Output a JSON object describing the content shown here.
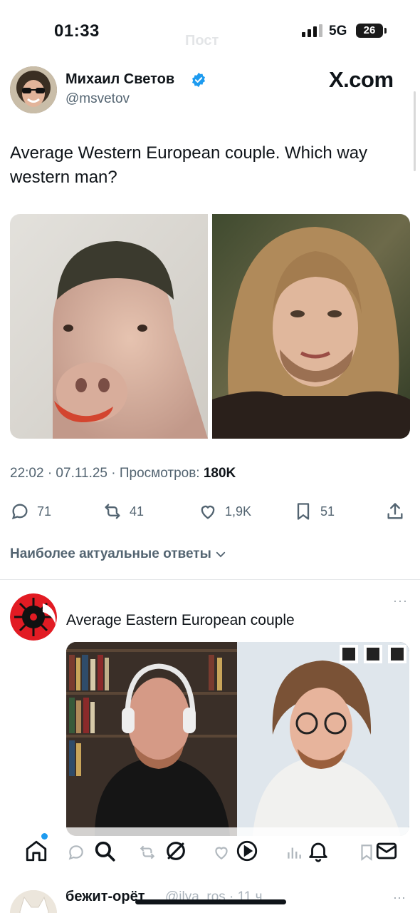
{
  "status_bar": {
    "time": "01:33",
    "network": "5G",
    "battery": "26"
  },
  "header": {
    "ghost_title": "Пост"
  },
  "author": {
    "name": "Михаил Светов",
    "handle": "@msvetov",
    "verified": true,
    "avatar_icon": "avatar-sunglasses-icon"
  },
  "brand": {
    "label": "X.com"
  },
  "tweet": {
    "text": "Average Western European couple. Which way western man?",
    "images": [
      "pig-with-haircut-image",
      "bearded-long-hair-face-image"
    ]
  },
  "meta": {
    "datetime": "22:02 · 07.11.25 · Просмотров: ",
    "views": "180K"
  },
  "actions": {
    "replies": "71",
    "reposts": "41",
    "likes": "1,9K",
    "bookmarks": "51",
    "icons": [
      "reply-icon",
      "repost-icon",
      "like-icon",
      "bookmark-icon",
      "share-icon"
    ]
  },
  "relevant_label": "Наиболее актуальные ответы",
  "reply": {
    "text": "Average Eastern European couple",
    "more": "···"
  },
  "tabbar": {
    "icons": [
      "home-icon",
      "search-icon",
      "grok-icon",
      "notifications-icon",
      "messages-icon"
    ],
    "accent": "#1d9bf0"
  },
  "peek": {
    "name": "бежит-орёт",
    "handle": "@ilya_ros · 11 ч",
    "more": "···"
  },
  "colors": {
    "text": "#0f1419",
    "secondary": "#536471",
    "verified": "#1d9bf0"
  }
}
